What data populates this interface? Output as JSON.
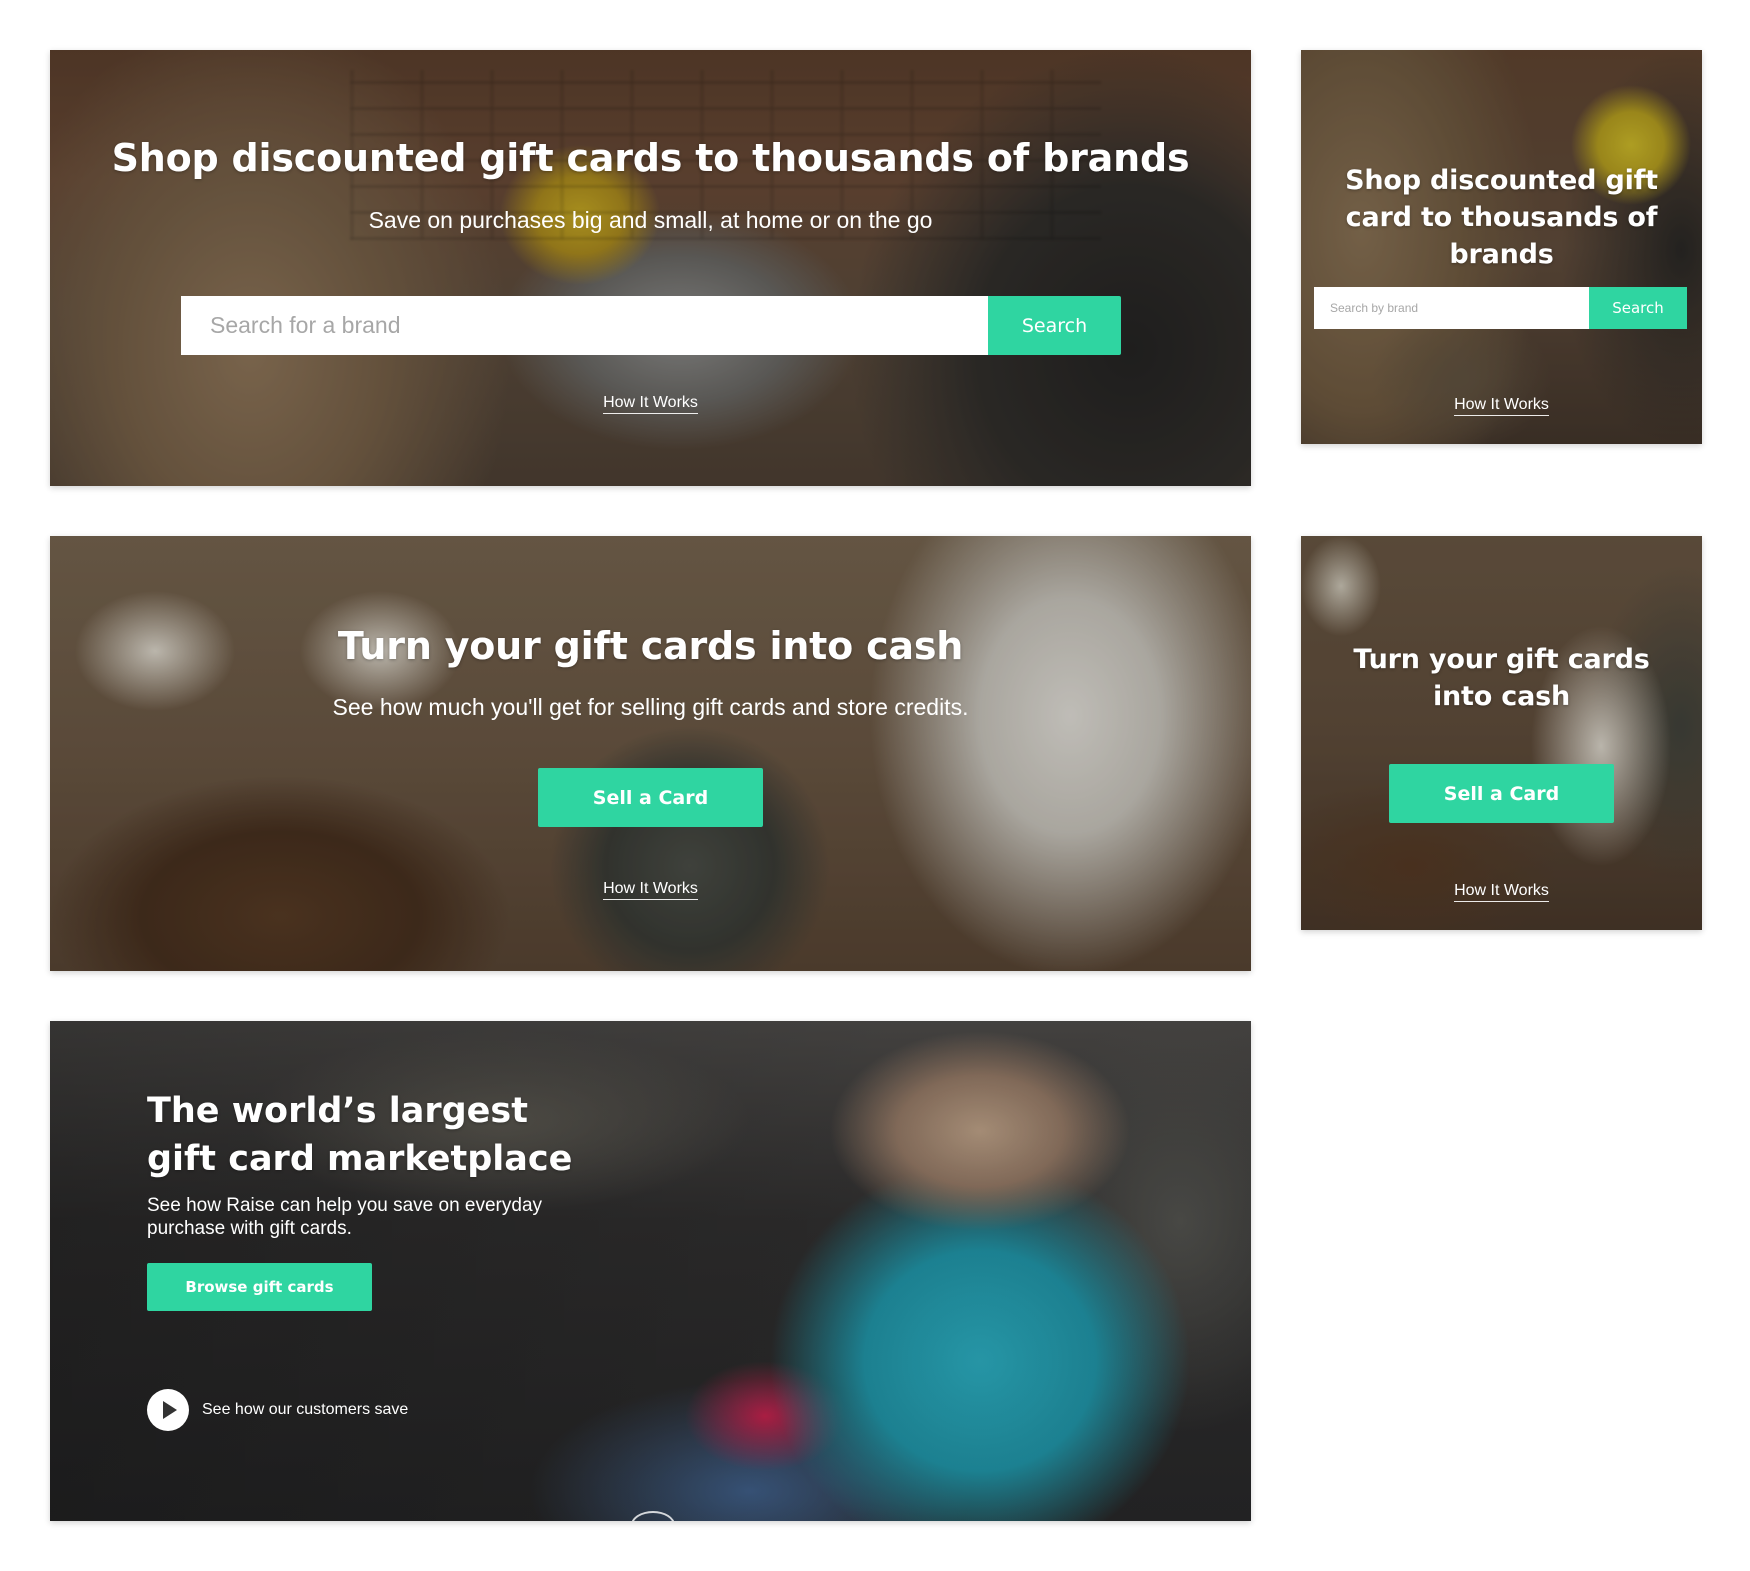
{
  "shop_wide": {
    "title": "Shop discounted gift cards to thousands of brands",
    "subtitle": "Save on purchases big and small, at home or on the go",
    "search_placeholder": "Search for a brand",
    "search_button": "Search",
    "how_it_works": "How It Works"
  },
  "shop_narrow": {
    "title": "Shop discounted gift card to thousands of brands",
    "search_placeholder": "Search by brand",
    "search_button": "Search",
    "how_it_works": "How It Works"
  },
  "sell_wide": {
    "title": "Turn your gift cards into cash",
    "subtitle": "See how much you'll get for selling gift cards and store credits.",
    "sell_button": "Sell a Card",
    "how_it_works": "How It Works"
  },
  "sell_narrow": {
    "title": "Turn your gift cards into cash",
    "sell_button": "Sell a Card",
    "how_it_works": "How It Works"
  },
  "marketplace": {
    "title": "The world’s largest gift card marketplace",
    "description": "See how Raise can help you save on everyday purchase with gift cards.",
    "browse_button": "Browse gift cards",
    "video_link": "See how our customers save"
  },
  "colors": {
    "accent": "#2fd5a1",
    "text": "#ffffff",
    "page_background": "#ffffff"
  },
  "icons": {
    "play": "play-icon"
  }
}
